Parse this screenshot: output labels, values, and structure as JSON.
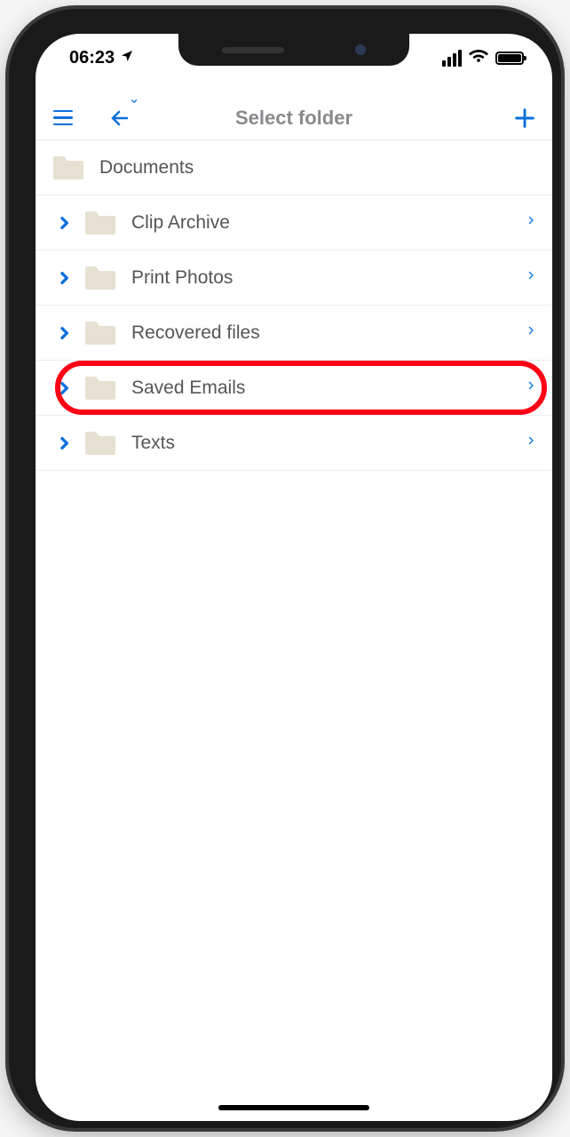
{
  "status": {
    "time": "06:23",
    "location_arrow": true,
    "signal_bars": 4,
    "wifi": true,
    "battery_full": true
  },
  "nav": {
    "title": "Select folder",
    "menu_label": "menu",
    "back_label": "back",
    "add_label": "add"
  },
  "root_folder": {
    "name": "Documents"
  },
  "folders": [
    {
      "name": "Clip Archive"
    },
    {
      "name": "Print Photos"
    },
    {
      "name": "Recovered files"
    },
    {
      "name": "Saved Emails",
      "highlighted": true
    },
    {
      "name": "Texts"
    }
  ],
  "colors": {
    "accent": "#0a6fdc",
    "highlight_ring": "#ff0015",
    "folder_fill": "#e6e1d3",
    "text_muted": "#8a8a8e"
  }
}
